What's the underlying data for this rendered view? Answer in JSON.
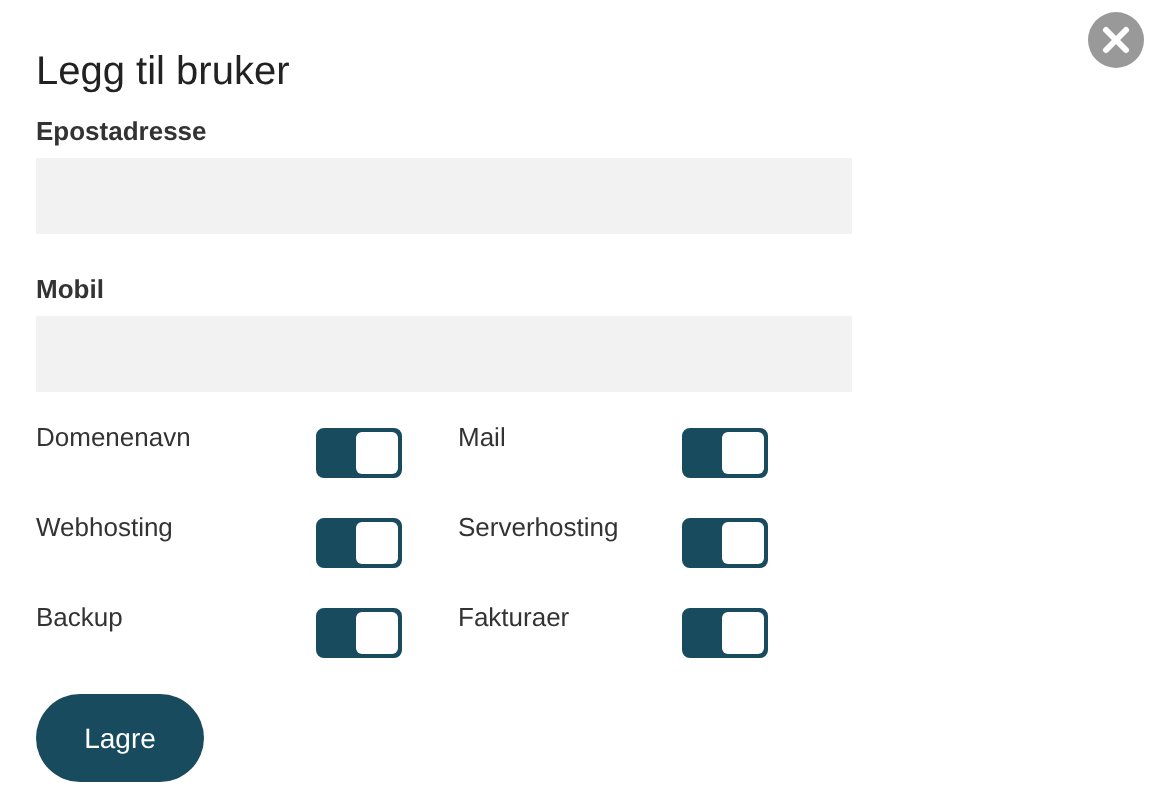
{
  "title": "Legg til bruker",
  "fields": [
    {
      "label": "Epostadresse"
    },
    {
      "label": "Mobil"
    }
  ],
  "toggles": [
    {
      "label": "Domenenavn",
      "on": true
    },
    {
      "label": "Mail",
      "on": true
    },
    {
      "label": "Webhosting",
      "on": true
    },
    {
      "label": "Serverhosting",
      "on": true
    },
    {
      "label": "Backup",
      "on": true
    },
    {
      "label": "Fakturaer",
      "on": true
    }
  ],
  "submit": "Lagre"
}
